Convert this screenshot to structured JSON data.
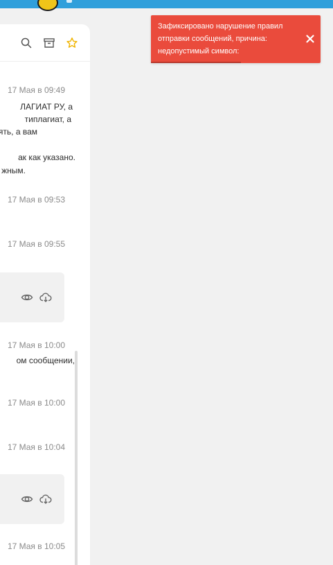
{
  "toast": {
    "lines": [
      "Зафиксировано нарушение правил",
      "отправки сообщений, причина:",
      "недопустимый символ:"
    ],
    "progress_fraction": 0.53,
    "colors": {
      "background": "#ea4b3c",
      "progress": "#b8362a"
    }
  },
  "header": {
    "icons": [
      "search-icon",
      "archive-icon",
      "star-icon"
    ],
    "star_color": "#f0b400"
  },
  "messages": [
    {
      "time": "17 Мая в 09:49",
      "text_lines": [
        "ЛАГИАТ РУ, а",
        "типлагиат, а",
        "ять, а вам",
        "",
        "ак как указано.",
        "жным."
      ]
    },
    {
      "time": "17 Мая в 09:53"
    },
    {
      "time": "17 Мая в 09:55"
    },
    {
      "time": "17 Мая в 10:00",
      "text_lines": [
        "ом сообщении,"
      ]
    },
    {
      "time": "17 Мая в 10:00"
    },
    {
      "time": "17 Мая в 10:04"
    },
    {
      "time": "17 Мая в 10:05"
    }
  ],
  "file_actions": [
    "eye-icon",
    "download-cloud-icon"
  ],
  "accent_color": "#2f9fdb"
}
